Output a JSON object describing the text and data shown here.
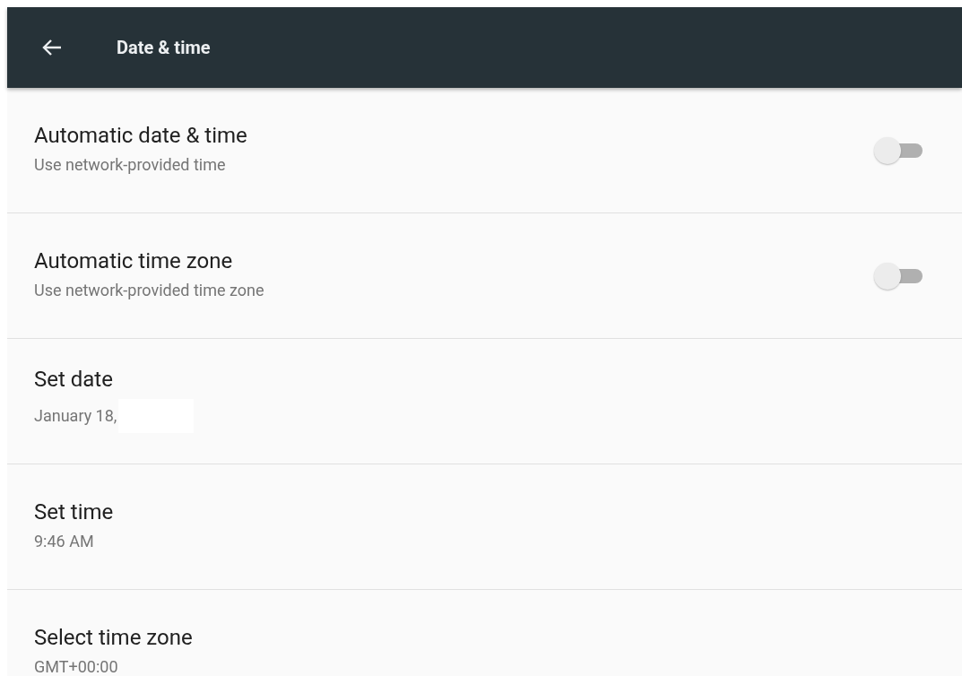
{
  "toolbar": {
    "title": "Date & time"
  },
  "settings": [
    {
      "kind": "toggle",
      "title": "Automatic date & time",
      "summary": "Use network-provided time",
      "on": false
    },
    {
      "kind": "toggle",
      "title": "Automatic time zone",
      "summary": "Use network-provided time zone",
      "on": false
    },
    {
      "kind": "plain",
      "title": "Set date",
      "summary": "January 18,",
      "redacted": true
    },
    {
      "kind": "plain",
      "title": "Set time",
      "summary": "9:46 AM"
    },
    {
      "kind": "plain",
      "title": "Select time zone",
      "summary": "GMT+00:00"
    }
  ]
}
